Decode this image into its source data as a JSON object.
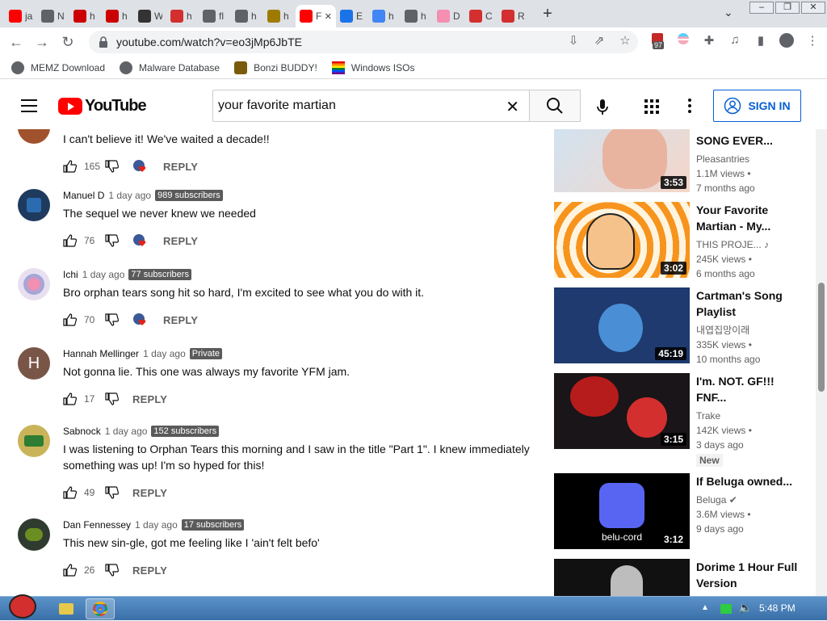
{
  "browser": {
    "tabs": [
      {
        "title": "ja",
        "color": "#ff0000"
      },
      {
        "title": "N",
        "color": "#5f6368"
      },
      {
        "title": "h",
        "color": "#cc0000"
      },
      {
        "title": "h",
        "color": "#cc0000"
      },
      {
        "title": "W",
        "color": "#333333"
      },
      {
        "title": "h",
        "color": "#d32f2f"
      },
      {
        "title": "fl",
        "color": "#5f6368"
      },
      {
        "title": "h",
        "color": "#5f6368"
      },
      {
        "title": "h",
        "color": "#9e7b00"
      },
      {
        "title": "F",
        "color": "#ff0000"
      },
      {
        "title": "E",
        "color": "#1a73e8"
      },
      {
        "title": "h",
        "color": "#4285f4"
      },
      {
        "title": "h",
        "color": "#5f6368"
      },
      {
        "title": "D",
        "color": "#f48fb1"
      },
      {
        "title": "C",
        "color": "#d32f2f"
      },
      {
        "title": "R",
        "color": "#d32f2f"
      }
    ],
    "url": "youtube.com/watch?v=eo3jMp6JbTE",
    "extension_badge": "97",
    "bookmarks": [
      {
        "label": "MEMZ Download"
      },
      {
        "label": "Malware Database"
      },
      {
        "label": "Bonzi BUDDY!"
      },
      {
        "label": "Windows ISOs"
      }
    ]
  },
  "youtube": {
    "logo_text": "YouTube",
    "search_value": "your favorite martian",
    "sign_in_label": "SIGN IN"
  },
  "comments": [
    {
      "author": "",
      "time": "",
      "badge": "",
      "text": "I can't believe it! We've waited a decade!!",
      "likes": "165",
      "hearted": true,
      "reply": "REPLY"
    },
    {
      "author": "Manuel D",
      "time": "1 day ago",
      "badge": "989 subscribers",
      "text": "The sequel we never knew we needed",
      "likes": "76",
      "hearted": true,
      "reply": "REPLY"
    },
    {
      "author": "Ichi",
      "time": "1 day ago",
      "badge": "77 subscribers",
      "text": "Bro orphan tears song hit so hard, I'm excited to see what you do with it.",
      "likes": "70",
      "hearted": true,
      "reply": "REPLY"
    },
    {
      "author": "Hannah Mellinger",
      "time": "1 day ago",
      "badge": "Private",
      "text": "Not gonna lie. This one was always my favorite YFM jam.",
      "likes": "17",
      "hearted": false,
      "reply": "REPLY",
      "avatar_letter": "H"
    },
    {
      "author": "Sabnock",
      "time": "1 day ago",
      "badge": "152 subscribers",
      "text": "I was listening to Orphan Tears this morning and I saw in the title \"Part 1\". I knew immediately something was up! I'm so hyped for this!",
      "likes": "49",
      "hearted": false,
      "reply": "REPLY"
    },
    {
      "author": "Dan Fennessey",
      "time": "1 day ago",
      "badge": "17 subscribers",
      "text": "This new sin-gle, got me feeling like I 'ain't felt befo'",
      "likes": "26",
      "hearted": false,
      "reply": "REPLY"
    }
  ],
  "sidebar_videos": [
    {
      "title": "SONG EVER...",
      "channel": "Pleasantries",
      "views": "1.1M views •",
      "age": "7 months ago",
      "duration": "3:53",
      "new": ""
    },
    {
      "title": "Your Favorite Martian - My...",
      "channel": "THIS PROJE... ♪",
      "views": "245K views •",
      "age": "6 months ago",
      "duration": "3:02",
      "new": ""
    },
    {
      "title": "Cartman's Song Playlist",
      "channel": "내엽집망이래",
      "views": "335K views •",
      "age": "10 months ago",
      "duration": "45:19",
      "new": ""
    },
    {
      "title": "I'm. NOT. GF!!! FNF...",
      "channel": "Trake",
      "views": "142K views •",
      "age": "3 days ago",
      "duration": "3:15",
      "new": "New"
    },
    {
      "title": "If Beluga owned...",
      "channel": "Beluga ✔",
      "views": "3.6M views •",
      "age": "9 days ago",
      "duration": "3:12",
      "new": "",
      "thumb_text": "belu-cord"
    },
    {
      "title": "Dorime 1 Hour Full Version",
      "channel": "",
      "views": "",
      "age": "",
      "duration": "",
      "new": ""
    }
  ],
  "taskbar": {
    "clock": "5:48 PM"
  }
}
